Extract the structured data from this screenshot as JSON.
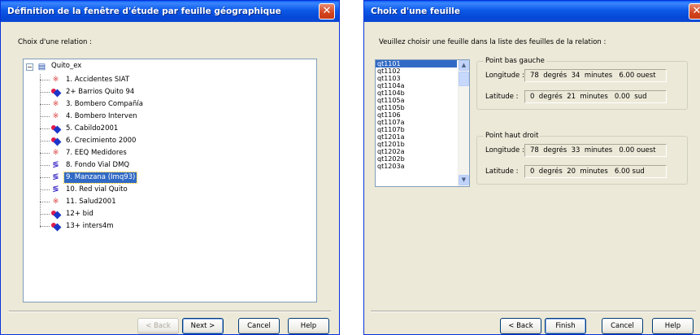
{
  "left_dialog": {
    "title": "Définition de la fenêtre d'étude par feuille géographique",
    "prompt": "Choix d'une relation :",
    "tree": {
      "root_label": "Quito_ex",
      "items": [
        {
          "label": "1. Accidentes SIAT",
          "icon": "points-icon"
        },
        {
          "label": "2+ Barrios Quito 94",
          "icon": "layer-icon"
        },
        {
          "label": "3. Bombero Compañía",
          "icon": "points-icon"
        },
        {
          "label": "4. Bombero Interven",
          "icon": "points-icon"
        },
        {
          "label": "5. Cabildo2001",
          "icon": "layer-icon"
        },
        {
          "label": "6. Crecimiento 2000",
          "icon": "layer-icon"
        },
        {
          "label": "7. EEQ Medidores",
          "icon": "points-icon"
        },
        {
          "label": "8. Fondo Vial DMQ",
          "icon": "lines-icon"
        },
        {
          "label": "9. Manzana (Imq93)",
          "icon": "lines-icon",
          "selected": true
        },
        {
          "label": "10. Red vial Quito",
          "icon": "lines-icon"
        },
        {
          "label": "11. Salud2001",
          "icon": "points-icon"
        },
        {
          "label": "12+ bid",
          "icon": "layer-icon"
        },
        {
          "label": "13+ inters4m",
          "icon": "layer-icon"
        }
      ]
    },
    "buttons": {
      "back": "< Back",
      "next": "Next >",
      "cancel": "Cancel",
      "help": "Help"
    }
  },
  "right_dialog": {
    "title": "Choix d'une feuille",
    "instruction": "Veuillez choisir une feuille dans la liste des feuilles de la relation :",
    "sheets": [
      "qt1101",
      "qt1102",
      "qt1103",
      "qt1104a",
      "qt1104b",
      "qt1105a",
      "qt1105b",
      "qt1106",
      "qt1107a",
      "qt1107b",
      "qt1201a",
      "qt1201b",
      "qt1202a",
      "qt1202b",
      "qt1203a"
    ],
    "selected_sheet": "qt1101",
    "bottom_left": {
      "title": "Point bas gauche",
      "longitude_label": "Longitude :",
      "longitude_value": "78  degrés  34  minutes   6.00 ouest",
      "latitude_label": "Latitude :",
      "latitude_value": "0  degrés  21  minutes   0.00  sud"
    },
    "top_right": {
      "title": "Point haut droit",
      "longitude_label": "Longitude :",
      "longitude_value": "78  degrés  33  minutes   0.00 ouest",
      "latitude_label": "Latitude :",
      "latitude_value": "0  degrés  20  minutes   6.00 sud"
    },
    "buttons": {
      "back": "< Back",
      "finish": "Finish",
      "cancel": "Cancel",
      "help": "Help"
    }
  }
}
